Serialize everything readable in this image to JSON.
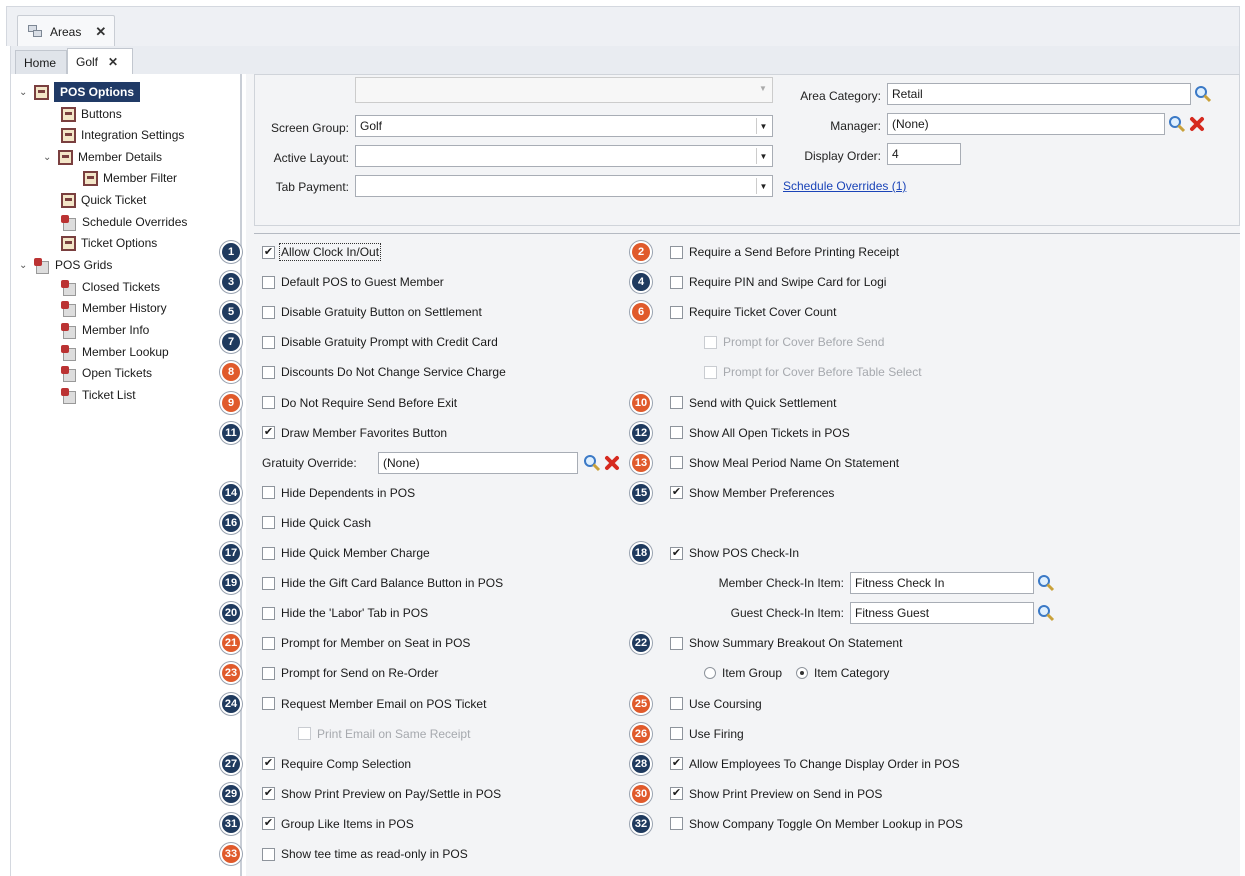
{
  "window_tab": {
    "title": "Areas",
    "close": "✕"
  },
  "tabs": [
    {
      "label": "Home"
    },
    {
      "label": "Golf",
      "close": "✕"
    }
  ],
  "tree": [
    {
      "label": "POS Options",
      "icon": "form-icon",
      "expanded": true,
      "selected": true
    },
    {
      "label": "Buttons",
      "icon": "form-icon"
    },
    {
      "label": "Integration Settings",
      "icon": "form-icon"
    },
    {
      "label": "Member Details",
      "icon": "form-icon",
      "expanded": true
    },
    {
      "label": "Member Filter",
      "icon": "form-icon"
    },
    {
      "label": "Quick Ticket",
      "icon": "form-icon"
    },
    {
      "label": "Schedule Overrides",
      "icon": "grid-icon"
    },
    {
      "label": "Ticket Options",
      "icon": "form-icon"
    },
    {
      "label": "POS Grids",
      "icon": "grid-icon",
      "expanded": true
    },
    {
      "label": "Closed Tickets",
      "icon": "grid-icon"
    },
    {
      "label": "Member History",
      "icon": "grid-icon"
    },
    {
      "label": "Member Info",
      "icon": "grid-icon"
    },
    {
      "label": "Member Lookup",
      "icon": "grid-icon"
    },
    {
      "label": "Open Tickets",
      "icon": "grid-icon"
    },
    {
      "label": "Ticket List",
      "icon": "grid-icon"
    }
  ],
  "header": {
    "screen_group_label": "Screen Group:",
    "screen_group_value": "Golf",
    "active_layout_label": "Active Layout:",
    "active_layout_value": "",
    "tab_payment_label": "Tab Payment:",
    "tab_payment_value": "",
    "area_category_label": "Area Category:",
    "area_category_value": "Retail",
    "manager_label": "Manager:",
    "manager_value": "(None)",
    "display_order_label": "Display Order:",
    "display_order_value": "4",
    "schedule_overrides_link": "Schedule Overrides (1)"
  },
  "options_left": [
    {
      "n": "1",
      "label": "Allow Clock In/Out",
      "checked": true,
      "color": "blue"
    },
    {
      "n": "3",
      "label": "Default POS to Guest Member",
      "checked": false,
      "color": "blue"
    },
    {
      "n": "5",
      "label": "Disable Gratuity Button on Settlement",
      "checked": false,
      "color": "blue"
    },
    {
      "n": "7",
      "label": "Disable Gratuity Prompt with Credit Card",
      "checked": false,
      "color": "blue"
    },
    {
      "n": "8",
      "label": "Discounts Do Not Change Service Charge",
      "checked": false,
      "color": "orange"
    },
    {
      "n": "9",
      "label": "Do Not Require Send Before Exit",
      "checked": false,
      "color": "orange"
    },
    {
      "n": "11",
      "label": "Draw Member Favorites Button",
      "checked": true,
      "color": "blue"
    },
    {
      "n": "14",
      "label": "Hide Dependents in POS",
      "checked": false,
      "color": "blue"
    },
    {
      "n": "16",
      "label": "Hide Quick Cash",
      "checked": false,
      "color": "blue"
    },
    {
      "n": "17",
      "label": "Hide Quick Member Charge",
      "checked": false,
      "color": "blue"
    },
    {
      "n": "19",
      "label": "Hide the Gift Card Balance Button in POS",
      "checked": false,
      "color": "blue"
    },
    {
      "n": "20",
      "label": "Hide the 'Labor' Tab in POS",
      "checked": false,
      "color": "blue"
    },
    {
      "n": "21",
      "label": "Prompt for Member on Seat in POS",
      "checked": false,
      "color": "orange"
    },
    {
      "n": "23",
      "label": "Prompt for Send on Re-Order",
      "checked": false,
      "color": "orange"
    },
    {
      "n": "24",
      "label": "Request Member Email on POS Ticket",
      "checked": false,
      "color": "blue"
    },
    {
      "n": "27",
      "label": "Require Comp Selection",
      "checked": true,
      "color": "blue"
    },
    {
      "n": "29",
      "label": "Show Print Preview on Pay/Settle in POS",
      "checked": true,
      "color": "blue"
    },
    {
      "n": "31",
      "label": "Group Like Items in POS",
      "checked": true,
      "color": "blue"
    },
    {
      "n": "33",
      "label": "Show tee time as read-only in POS",
      "checked": false,
      "color": "orange"
    }
  ],
  "gratuity_override": {
    "label": "Gratuity Override:",
    "value": "(None)"
  },
  "print_email_same_receipt": "Print Email on Same Receipt",
  "options_right": [
    {
      "n": "2",
      "label": "Require a Send Before Printing Receipt",
      "checked": false,
      "color": "orange"
    },
    {
      "n": "4",
      "label": "Require PIN and Swipe Card for Logi",
      "checked": false,
      "color": "blue"
    },
    {
      "n": "6",
      "label": "Require Ticket Cover Count",
      "checked": false,
      "color": "orange"
    },
    {
      "n": "10",
      "label": "Send with Quick Settlement",
      "checked": false,
      "color": "orange"
    },
    {
      "n": "12",
      "label": "Show All Open Tickets in POS",
      "checked": false,
      "color": "blue"
    },
    {
      "n": "13",
      "label": "Show Meal Period Name On Statement",
      "checked": false,
      "color": "orange"
    },
    {
      "n": "15",
      "label": "Show Member Preferences",
      "checked": true,
      "color": "blue"
    },
    {
      "n": "18",
      "label": "Show POS Check-In",
      "checked": true,
      "color": "blue"
    },
    {
      "n": "22",
      "label": "Show Summary Breakout On Statement",
      "checked": false,
      "color": "blue"
    },
    {
      "n": "25",
      "label": "Use Coursing",
      "checked": false,
      "color": "orange"
    },
    {
      "n": "26",
      "label": "Use Firing",
      "checked": false,
      "color": "orange"
    },
    {
      "n": "28",
      "label": "Allow Employees To Change Display Order in POS",
      "checked": true,
      "color": "blue"
    },
    {
      "n": "30",
      "label": "Show Print Preview on Send in POS",
      "checked": true,
      "color": "orange"
    },
    {
      "n": "32",
      "label": "Show Company Toggle On Member Lookup in POS",
      "checked": false,
      "color": "blue"
    }
  ],
  "cover_sub": [
    "Prompt for Cover Before Send",
    "Prompt for Cover Before Table Select"
  ],
  "checkin": {
    "member_label": "Member Check-In Item:",
    "member_value": "Fitness Check In",
    "guest_label": "Guest Check-In Item:",
    "guest_value": "Fitness Guest"
  },
  "summary_breakout": {
    "option1": "Item Group",
    "option2": "Item Category",
    "selected": "Item Category"
  },
  "colors": {
    "badge_blue": "#1f3a5e",
    "badge_orange": "#e05a2b",
    "selected_tree": "#203a66",
    "link": "#1a44b8"
  }
}
